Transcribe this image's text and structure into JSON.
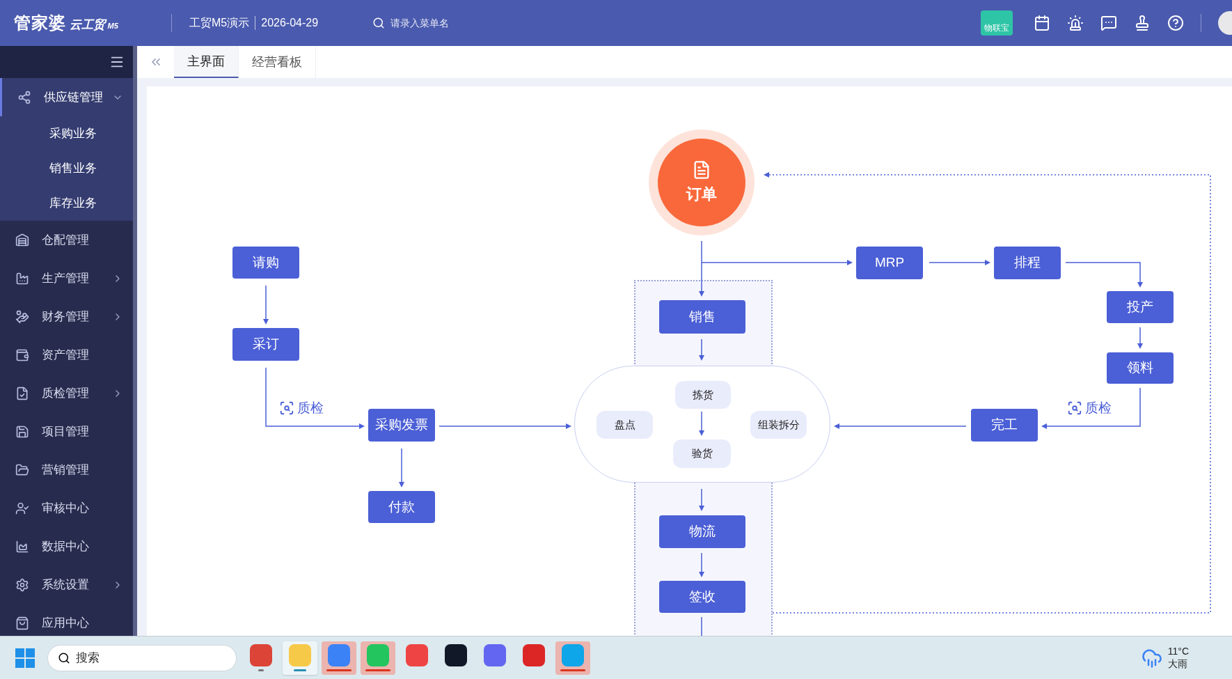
{
  "header": {
    "logo": "管家婆",
    "logo_sub": "云工贸",
    "logo_edition": "M5",
    "company": "工贸M5演示",
    "date": "2026-04-29",
    "search": {
      "placeholder": "请录入菜单名"
    },
    "badge": "物联宝"
  },
  "tabs": [
    {
      "label": "主界面",
      "selected": true
    },
    {
      "label": "经营看板",
      "selected": false
    }
  ],
  "sidebar": {
    "items": [
      {
        "label": "供应链管理",
        "expanded": true,
        "has_children": true,
        "children": [
          {
            "label": "采购业务"
          },
          {
            "label": "销售业务"
          },
          {
            "label": "库存业务"
          }
        ]
      },
      {
        "label": "仓配管理",
        "expanded": false,
        "has_children": false
      },
      {
        "label": "生产管理",
        "expanded": false,
        "has_children": true
      },
      {
        "label": "财务管理",
        "expanded": false,
        "has_children": true
      },
      {
        "label": "资产管理",
        "expanded": false,
        "has_children": false
      },
      {
        "label": "质检管理",
        "expanded": false,
        "has_children": true
      },
      {
        "label": "项目管理",
        "expanded": false,
        "has_children": false
      },
      {
        "label": "营销管理",
        "expanded": false,
        "has_children": false
      },
      {
        "label": "审核中心",
        "expanded": false,
        "has_children": false
      },
      {
        "label": "数据中心",
        "expanded": false,
        "has_children": false
      },
      {
        "label": "系统设置",
        "expanded": false,
        "has_children": true
      },
      {
        "label": "应用中心",
        "expanded": false,
        "has_children": false
      }
    ]
  },
  "diagram": {
    "nodes": [
      {
        "kind": "hub",
        "label": "订单"
      },
      {
        "kind": "step",
        "label": "请购"
      },
      {
        "kind": "step",
        "label": "采订"
      },
      {
        "kind": "step",
        "label": "采购发票"
      },
      {
        "kind": "step",
        "label": "付款"
      },
      {
        "kind": "step",
        "label": "销售"
      },
      {
        "kind": "step",
        "label": "物流"
      },
      {
        "kind": "step",
        "label": "签收"
      },
      {
        "kind": "step",
        "label": "MRP"
      },
      {
        "kind": "step",
        "label": "排程"
      },
      {
        "kind": "step",
        "label": "投产"
      },
      {
        "kind": "step",
        "label": "领料"
      },
      {
        "kind": "step",
        "label": "完工"
      },
      {
        "kind": "sub",
        "label": "拣货"
      },
      {
        "kind": "sub",
        "label": "盘点"
      },
      {
        "kind": "sub",
        "label": "组装拆分"
      },
      {
        "kind": "sub",
        "label": "验货"
      },
      {
        "kind": "check",
        "label": "质检"
      },
      {
        "kind": "check",
        "label": "质检"
      }
    ]
  },
  "taskbar": {
    "search": {
      "placeholder": "搜索"
    },
    "apps": [
      {
        "running": true,
        "focused": false,
        "flashing": false
      },
      {
        "running": true,
        "focused": true,
        "flashing": false
      },
      {
        "running": true,
        "focused": false,
        "flashing": true
      },
      {
        "running": true,
        "focused": false,
        "flashing": true
      },
      {
        "running": false,
        "focused": false,
        "flashing": false
      },
      {
        "running": false,
        "focused": false,
        "flashing": false
      },
      {
        "running": false,
        "focused": false,
        "flashing": false
      },
      {
        "running": false,
        "focused": false,
        "flashing": false
      },
      {
        "running": true,
        "focused": false,
        "flashing": true
      }
    ],
    "weather": {
      "temperature": "11°C",
      "condition": "大雨"
    }
  }
}
